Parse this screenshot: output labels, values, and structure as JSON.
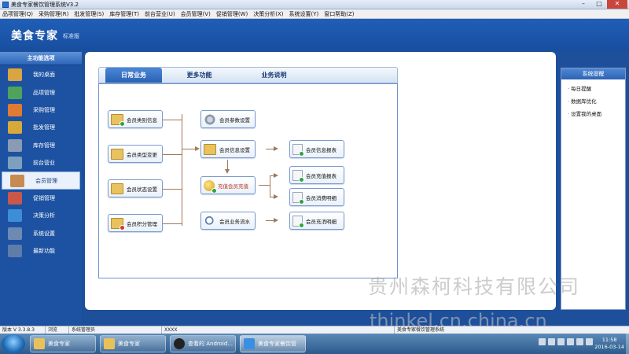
{
  "window": {
    "title": "美食专家餐饮管理系统V3.2",
    "min": "–",
    "max": "□",
    "close": "✕"
  },
  "menu": [
    "品项管理(Q)",
    "采购管理(R)",
    "批发管理(S)",
    "库存管理(T)",
    "前台营业(U)",
    "会员管理(V)",
    "促销管理(W)",
    "决策分析(X)",
    "系统设置(Y)",
    "窗口帮助(Z)"
  ],
  "header": {
    "brand": "美食专家",
    "edition": "标准版"
  },
  "sidebar": {
    "title": "主功能选项",
    "items": [
      {
        "label": "我的桌面",
        "icon": "home-icon",
        "color": "#d9a441"
      },
      {
        "label": "品项管理",
        "icon": "item-icon",
        "color": "#4fa35a"
      },
      {
        "label": "采购管理",
        "icon": "purchase-icon",
        "color": "#e07b33"
      },
      {
        "label": "批发管理",
        "icon": "wholesale-icon",
        "color": "#d6a93a"
      },
      {
        "label": "库存管理",
        "icon": "inventory-icon",
        "color": "#8a9bb5"
      },
      {
        "label": "前台营业",
        "icon": "cart-icon",
        "color": "#7f9fbf"
      },
      {
        "label": "会员管理",
        "icon": "member-icon",
        "color": "#c78b52"
      },
      {
        "label": "促销管理",
        "icon": "promotion-icon",
        "color": "#c9574a"
      },
      {
        "label": "决策分析",
        "icon": "chart-icon",
        "color": "#3c8ed6"
      },
      {
        "label": "系统设置",
        "icon": "settings-icon",
        "color": "#6d8ab5"
      },
      {
        "label": "最新功能",
        "icon": "new-feature-icon",
        "color": "#5f7da8"
      }
    ],
    "active": 6
  },
  "tabs": [
    "日常业务",
    "更多功能",
    "业务说明"
  ],
  "nodes": {
    "category": "会员类别信息",
    "type_change": "会员类型变更",
    "status_setting": "会员状态设置",
    "points": "会员积分管理",
    "params": "会员参数设置",
    "info_setting": "会员信息设置",
    "recharge": "充值会员充值",
    "business_flow": "会员业务流水",
    "info_report": "会员信息报表",
    "recharge_report": "会员充值报表",
    "consume_detail": "会员消费明细",
    "recharge_detail": "会员充消明细"
  },
  "reminder": {
    "title": "系统提醒",
    "items": [
      "每日提醒",
      "数据库优化",
      "设置我的桌面"
    ]
  },
  "statusbar": {
    "version": "版本 V 3.3.8.3",
    "mode": "浏览",
    "user": "系统管理员",
    "code": "XXXX",
    "app": "美食专家餐饮管理系统"
  },
  "taskbar": {
    "tasks": [
      "美食专家",
      "美食专家",
      "查看的 Android...",
      "美食专家餐饮管"
    ],
    "time": "11:58",
    "date": "2016-03-14"
  },
  "watermark": {
    "company": "贵州森柯科技有限公司",
    "site": "thinkel.cn.china.cn"
  }
}
